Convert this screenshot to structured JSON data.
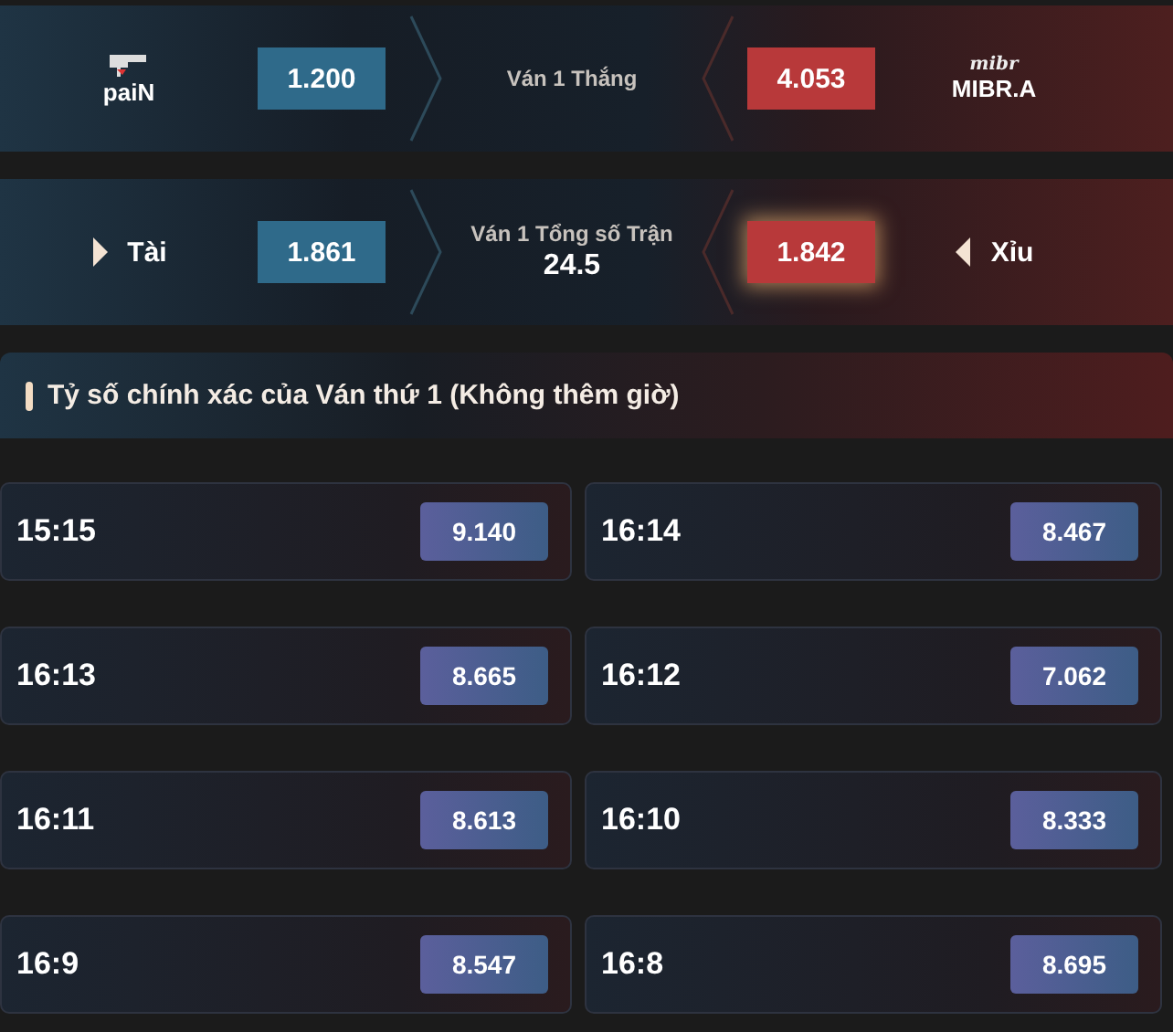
{
  "markets": [
    {
      "kind": "teams",
      "label": "Ván 1 Thắng",
      "left": {
        "name": "paiN",
        "odds": "1.200",
        "selected": false
      },
      "right": {
        "name": "MIBR.A",
        "logo": "mibr",
        "odds": "4.053",
        "selected": false
      }
    },
    {
      "kind": "totals",
      "label": "Ván 1 Tổng số Trận",
      "line": "24.5",
      "left": {
        "name": "Tài",
        "odds": "1.861",
        "selected": false
      },
      "right": {
        "name": "Xỉu",
        "odds": "1.842",
        "selected": true
      }
    }
  ],
  "section": {
    "title": "Tỷ số chính xác của Ván thứ 1 (Không thêm giờ)"
  },
  "scores": [
    {
      "score": "15:15",
      "odds": "9.140",
      "selected": false
    },
    {
      "score": "16:14",
      "odds": "8.467",
      "selected": false
    },
    {
      "score": "16:13",
      "odds": "8.665",
      "selected": false
    },
    {
      "score": "16:12",
      "odds": "7.062",
      "selected": false
    },
    {
      "score": "16:11",
      "odds": "8.613",
      "selected": false
    },
    {
      "score": "16:10",
      "odds": "8.333",
      "selected": false
    },
    {
      "score": "16:9",
      "odds": "8.547",
      "selected": false
    },
    {
      "score": "16:8",
      "odds": "8.695",
      "selected": false
    }
  ]
}
